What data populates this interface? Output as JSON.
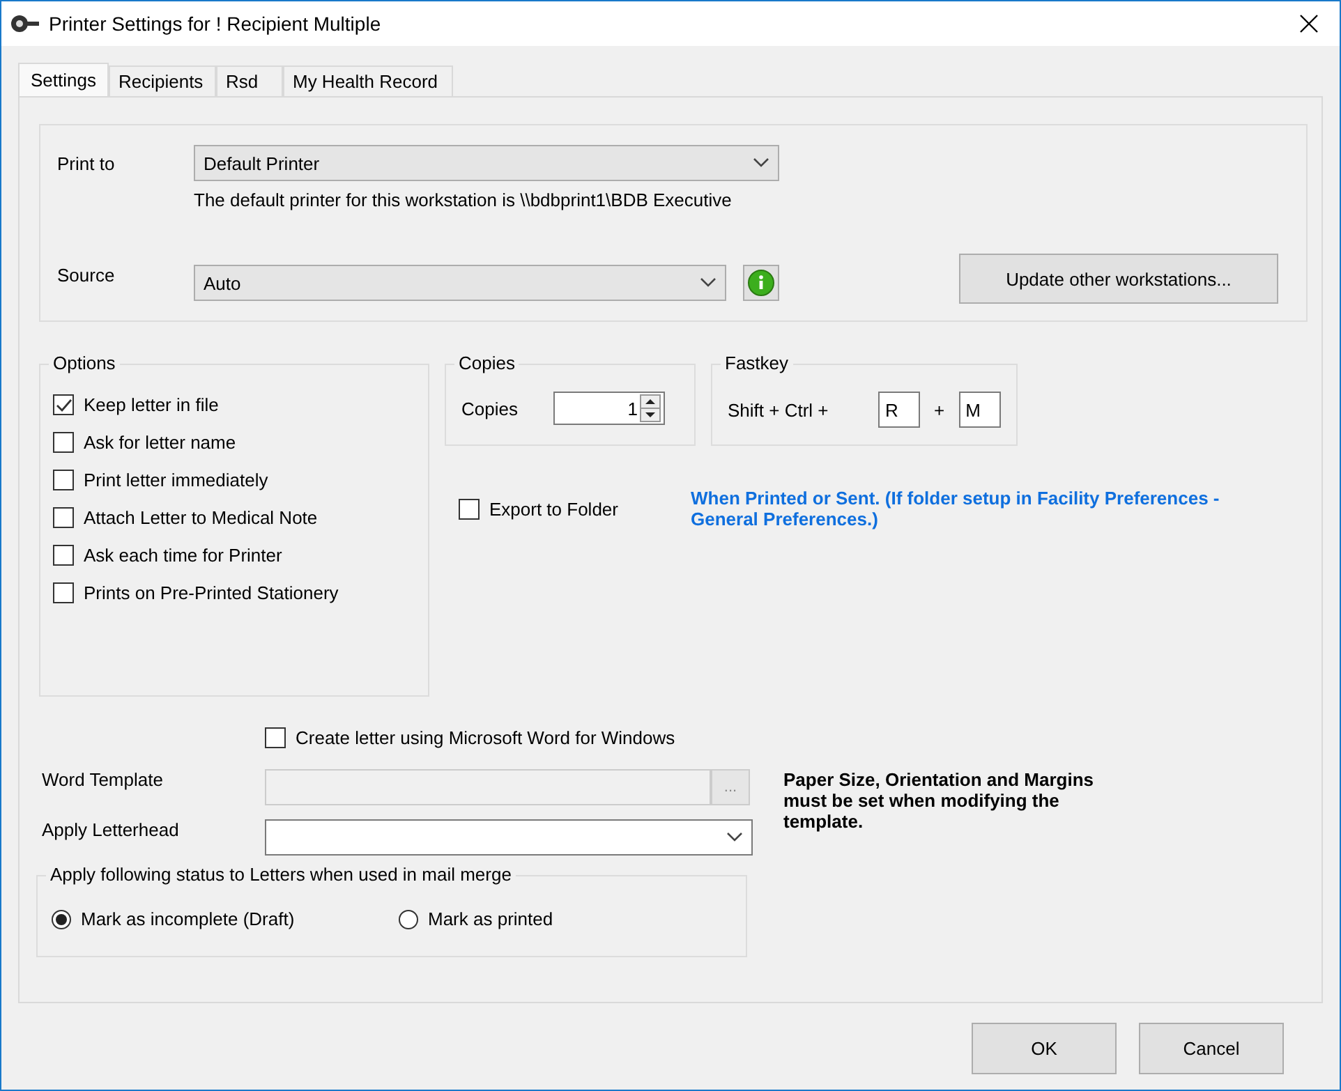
{
  "window": {
    "title": "Printer Settings for ! Recipient Multiple"
  },
  "tabs": [
    {
      "label": "Settings",
      "selected": true
    },
    {
      "label": "Recipients",
      "selected": false
    },
    {
      "label": "Rsd",
      "selected": false
    },
    {
      "label": "My Health Record",
      "selected": false
    }
  ],
  "printer": {
    "print_to_label": "Print to",
    "print_to_value": "Default Printer",
    "default_note": "The default printer for this workstation is \\\\bdbprint1\\BDB Executive",
    "source_label": "Source",
    "source_value": "Auto",
    "update_button": "Update other workstations..."
  },
  "options": {
    "title": "Options",
    "items": [
      {
        "label": "Keep letter in file",
        "checked": true
      },
      {
        "label": "Ask for letter name",
        "checked": false
      },
      {
        "label": "Print letter immediately",
        "checked": false
      },
      {
        "label": "Attach Letter to Medical Note",
        "checked": false
      },
      {
        "label": "Ask each time for Printer",
        "checked": false
      },
      {
        "label": "Prints on Pre-Printed Stationery",
        "checked": false
      }
    ]
  },
  "copies": {
    "title": "Copies",
    "label": "Copies",
    "value": "1"
  },
  "fastkey": {
    "title": "Fastkey",
    "label": "Shift + Ctrl +",
    "key_1": "R",
    "joiner": "+",
    "key_2": "M"
  },
  "export": {
    "label": "Export to Folder",
    "checked": false,
    "note": "When Printed or Sent. (If folder setup in Facility Preferences - General Preferences.)"
  },
  "word": {
    "label": "Create letter using Microsoft Word for Windows",
    "checked": false,
    "template_label": "Word Template",
    "template_disabled": true,
    "browse_button": "...",
    "note": "Paper Size, Orientation and Margins must be set when modifying the template.",
    "letterhead_label": "Apply Letterhead"
  },
  "status_group": {
    "title": "Apply following status to Letters when used in mail merge",
    "options": [
      {
        "label": "Mark as incomplete (Draft)",
        "selected": true
      },
      {
        "label": "Mark as printed",
        "selected": false
      }
    ]
  },
  "buttons": [
    "OK",
    "Cancel"
  ]
}
